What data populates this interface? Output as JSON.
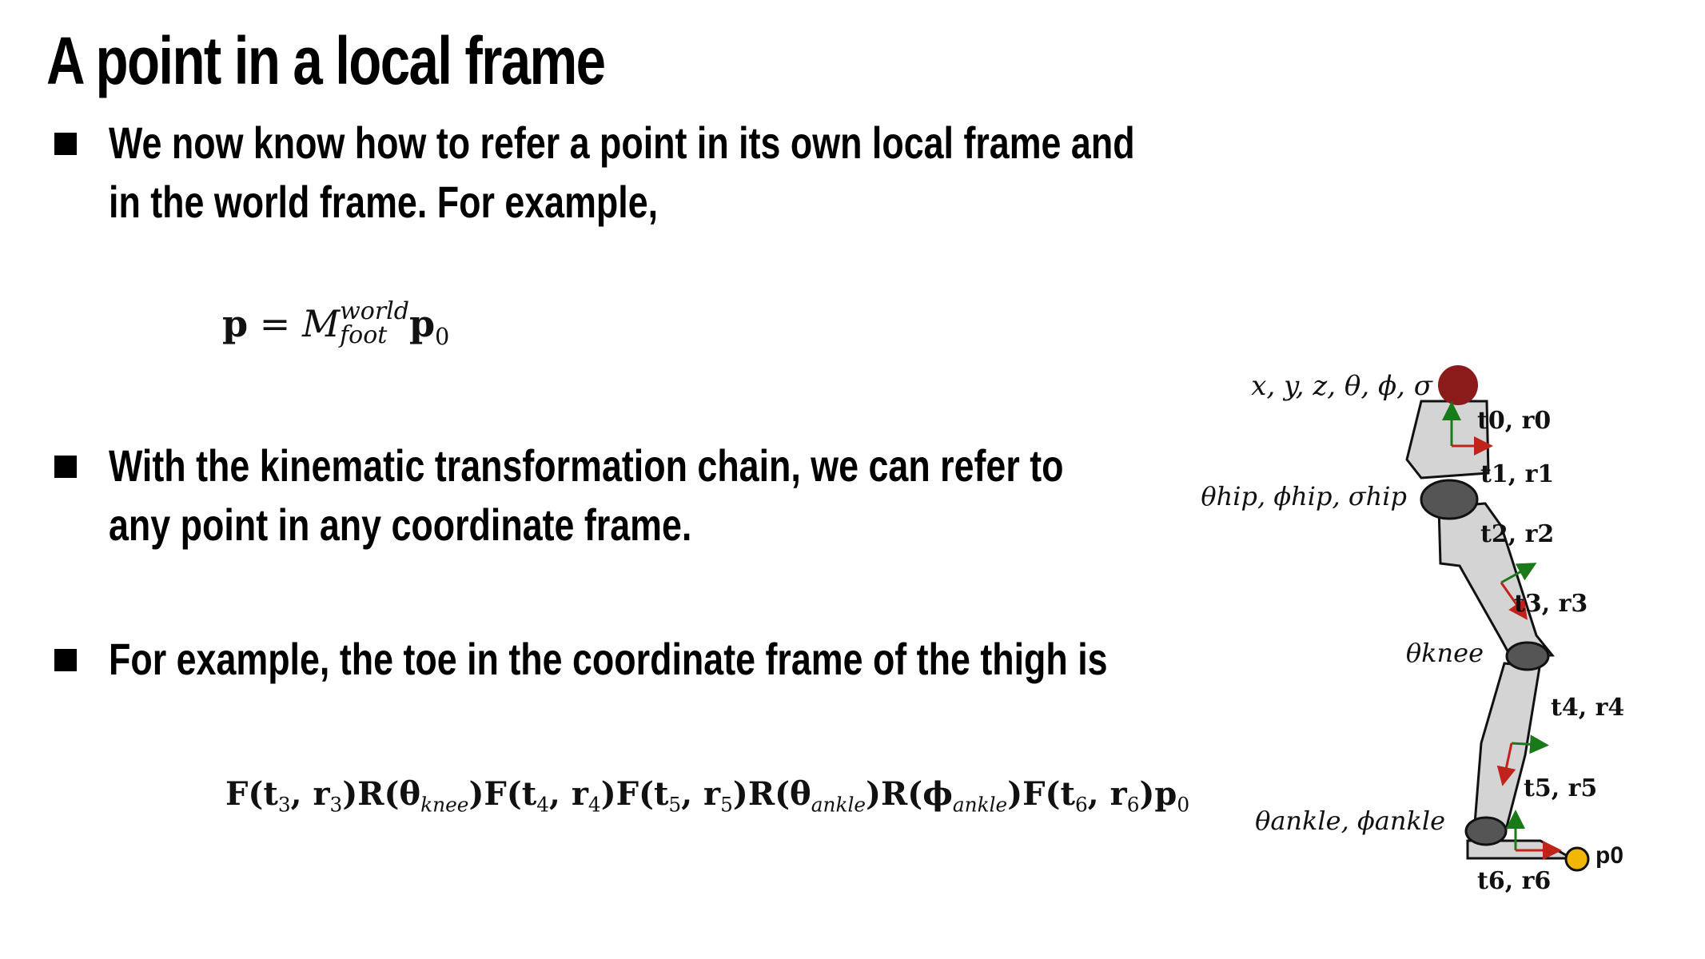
{
  "title": "A point in a local frame",
  "bullets": [
    {
      "line1": "We now know how to refer a point in its own local frame and",
      "line2": "in the world frame. For example,"
    },
    {
      "line1": "With the kinematic transformation chain, we can refer to",
      "line2": "any point in any coordinate frame."
    },
    {
      "line1": "For example, the toe in the coordinate frame of the thigh is",
      "line2": ""
    }
  ],
  "formula1": {
    "lhs": "p",
    "eq": "=",
    "M": "M",
    "sup": "world",
    "sub": "foot",
    "p0": "p",
    "p0_sub": "0"
  },
  "formula2": {
    "parts": [
      "F(t",
      "3",
      ", r",
      "3",
      ")R(θ",
      "knee",
      ")F(t",
      "4",
      ", r",
      "4",
      ")F(t",
      "5",
      ", r",
      "5",
      ")R(θ",
      "ankle",
      ")R(ϕ",
      "ankle",
      ")F(t",
      "6",
      ", r",
      "6",
      ")p",
      "0"
    ]
  },
  "figure": {
    "root_label": "x, y, z, θ, ϕ, σ",
    "hip_label": "θhip, ϕhip, σhip",
    "knee_label": "θknee",
    "ankle_label": "θankle, ϕankle",
    "frames": [
      "t0, r0",
      "t1, r1",
      "t2, r2",
      "t3, r3",
      "t4, r4",
      "t5, r5",
      "t6, r6"
    ],
    "point_label": "p0",
    "colors": {
      "root_joint": "#8b1a1a",
      "segment_fill": "#d4d4d4",
      "joint_fill": "#555555",
      "toe_point": "#f2b705",
      "axis_green": "#1a7a1a",
      "axis_red": "#c0231a"
    }
  }
}
